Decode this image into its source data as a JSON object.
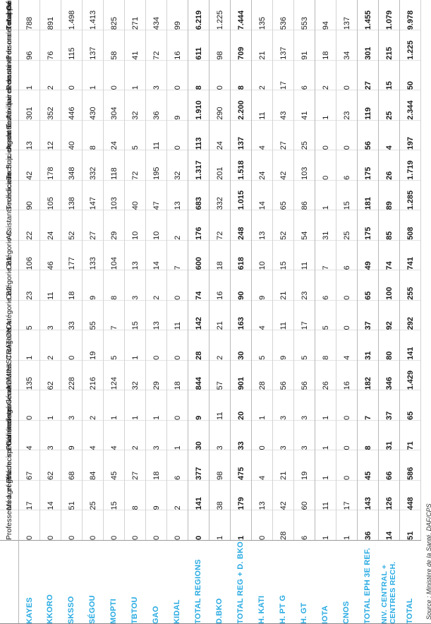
{
  "meta": {
    "accent_color": "#29abe2",
    "source_note": "Source : Ministère de la Santé, DAF/CPS"
  },
  "table": {
    "stub_header": "",
    "columns": [
      {
        "key": "prof_agreges",
        "label": "Professeurs agrégés",
        "bold": false
      },
      {
        "key": "med_pharm_spec",
        "label": "Méd. et Pharm. spécialistes",
        "bold": false
      },
      {
        "key": "med_gen",
        "label": "Médecins Généralistes",
        "bold": false
      },
      {
        "key": "pharm_gen",
        "label": "Pharmaciens Généralistes",
        "bold": false
      },
      {
        "key": "ingenieurs",
        "label": "Ingénieurs",
        "bold": false
      },
      {
        "key": "administration",
        "label": "ADMINISTRATION",
        "bold": false
      },
      {
        "key": "cat_a",
        "label": "Catégorie A",
        "bold": false
      },
      {
        "key": "cat_b2",
        "label": "Catégorie B2",
        "bold": false
      },
      {
        "key": "cat_b1",
        "label": "Catégorie B1",
        "bold": false
      },
      {
        "key": "cat_c",
        "label": "Catégorie C",
        "bold": false
      },
      {
        "key": "assist_med",
        "label": "Assistants médicaux",
        "bold": false
      },
      {
        "key": "tech_sup",
        "label": "Techniciens Sup. de santé",
        "bold": false
      },
      {
        "key": "tech_sante",
        "label": "Techniciens de santé",
        "bold": false
      },
      {
        "key": "agent_tech",
        "label": "Agent Technique de santé",
        "bold": false
      },
      {
        "key": "aux_sante",
        "label": "Auxiliaires de santé",
        "bold": false
      },
      {
        "key": "pers_maint",
        "label": "Personnel de maintenance",
        "bold": false
      },
      {
        "key": "pers_appui",
        "label": "Personnel d'appui",
        "bold": false
      },
      {
        "key": "total_general",
        "label": "Total Général",
        "bold": true
      }
    ],
    "rows": [
      {
        "label": "KAYES",
        "two_line": false,
        "bold": false,
        "band": false,
        "values": [
          "0",
          "17",
          "67",
          "4",
          "0",
          "135",
          "1",
          "5",
          "23",
          "106",
          "22",
          "90",
          "42",
          "13",
          "301",
          "1",
          "96",
          "788"
        ]
      },
      {
        "label": "KKORO",
        "two_line": false,
        "bold": false,
        "band": false,
        "values": [
          "0",
          "14",
          "62",
          "3",
          "1",
          "62",
          "2",
          "3",
          "11",
          "46",
          "24",
          "105",
          "178",
          "12",
          "352",
          "2",
          "76",
          "891"
        ]
      },
      {
        "label": "SKSSO",
        "two_line": false,
        "bold": false,
        "band": false,
        "values": [
          "0",
          "51",
          "68",
          "9",
          "3",
          "228",
          "0",
          "33",
          "18",
          "177",
          "52",
          "138",
          "348",
          "40",
          "446",
          "0",
          "115",
          "1.498"
        ]
      },
      {
        "label": "SÉGOU",
        "two_line": false,
        "bold": false,
        "band": false,
        "values": [
          "0",
          "25",
          "84",
          "4",
          "2",
          "216",
          "19",
          "55",
          "9",
          "133",
          "27",
          "147",
          "332",
          "8",
          "430",
          "1",
          "137",
          "1.413"
        ]
      },
      {
        "label": "MOPTI",
        "two_line": false,
        "bold": false,
        "band": false,
        "values": [
          "0",
          "15",
          "45",
          "4",
          "1",
          "124",
          "5",
          "7",
          "8",
          "104",
          "29",
          "103",
          "118",
          "24",
          "304",
          "0",
          "58",
          "825"
        ]
      },
      {
        "label": "TBTOU",
        "two_line": false,
        "bold": false,
        "band": false,
        "values": [
          "0",
          "8",
          "27",
          "2",
          "1",
          "32",
          "1",
          "15",
          "3",
          "13",
          "10",
          "40",
          "72",
          "5",
          "32",
          "1",
          "41",
          "271"
        ]
      },
      {
        "label": "GAO",
        "two_line": false,
        "bold": false,
        "band": false,
        "values": [
          "0",
          "9",
          "18",
          "3",
          "1",
          "29",
          "0",
          "13",
          "2",
          "14",
          "10",
          "47",
          "195",
          "11",
          "36",
          "3",
          "72",
          "434"
        ]
      },
      {
        "label": "KIDAL",
        "two_line": false,
        "bold": false,
        "band": true,
        "values": [
          "0",
          "2",
          "6",
          "1",
          "0",
          "18",
          "0",
          "11",
          "0",
          "7",
          "2",
          "13",
          "32",
          "0",
          "9",
          "0",
          "16",
          "99"
        ]
      },
      {
        "label": "TOTAL REGIONS",
        "two_line": false,
        "bold": true,
        "band": true,
        "values": [
          "0",
          "141",
          "377",
          "30",
          "9",
          "844",
          "28",
          "142",
          "74",
          "600",
          "176",
          "683",
          "1.317",
          "113",
          "1.910",
          "8",
          "611",
          "6.219"
        ]
      },
      {
        "label": "D.BKO",
        "two_line": false,
        "bold": false,
        "band": true,
        "values": [
          "1",
          "38",
          "98",
          "3",
          "11",
          "57",
          "2",
          "21",
          "16",
          "18",
          "72",
          "332",
          "201",
          "24",
          "290",
          "0",
          "98",
          "1.225"
        ]
      },
      {
        "label": "TOTAL REG + D. BKO",
        "two_line": false,
        "bold": true,
        "band": true,
        "values": [
          "1",
          "179",
          "475",
          "33",
          "20",
          "901",
          "30",
          "163",
          "90",
          "618",
          "248",
          "1.015",
          "1.518",
          "137",
          "2.200",
          "8",
          "709",
          "7.444"
        ]
      },
      {
        "label": "H. KATI",
        "two_line": false,
        "bold": false,
        "band": false,
        "values": [
          "0",
          "13",
          "4",
          "0",
          "1",
          "28",
          "5",
          "4",
          "9",
          "10",
          "13",
          "14",
          "24",
          "4",
          "11",
          "2",
          "21",
          "135"
        ]
      },
      {
        "label": "H. PT G",
        "two_line": false,
        "bold": false,
        "band": false,
        "values": [
          "28",
          "42",
          "21",
          "3",
          "3",
          "56",
          "9",
          "11",
          "21",
          "15",
          "52",
          "65",
          "42",
          "27",
          "43",
          "17",
          "137",
          "536"
        ]
      },
      {
        "label": "H. GT",
        "two_line": false,
        "bold": false,
        "band": true,
        "values": [
          "6",
          "60",
          "19",
          "3",
          "3",
          "56",
          "5",
          "17",
          "23",
          "11",
          "54",
          "86",
          "103",
          "25",
          "41",
          "6",
          "91",
          "553"
        ]
      },
      {
        "label": "IOTA",
        "two_line": false,
        "bold": false,
        "band": false,
        "values": [
          "1",
          "11",
          "1",
          "1",
          "1",
          "26",
          "8",
          "5",
          "6",
          "7",
          "31",
          "1",
          "0",
          "0",
          "1",
          "2",
          "18",
          "94"
        ]
      },
      {
        "label": "CNOS",
        "two_line": false,
        "bold": false,
        "band": true,
        "values": [
          "1",
          "17",
          "0",
          "0",
          "0",
          "16",
          "4",
          "0",
          "0",
          "6",
          "25",
          "15",
          "6",
          "0",
          "23",
          "0",
          "34",
          "137"
        ]
      },
      {
        "label": "TOTAL EPH 3E REF.",
        "two_line": false,
        "bold": true,
        "band": true,
        "values": [
          "36",
          "143",
          "45",
          "8",
          "7",
          "182",
          "31",
          "37",
          "65",
          "49",
          "175",
          "181",
          "175",
          "56",
          "119",
          "27",
          "301",
          "1.455"
        ]
      },
      {
        "label": "NIV. CENTRAL + CENTRES RECH.",
        "two_line": true,
        "bold": true,
        "band": true,
        "values": [
          "14",
          "126",
          "66",
          "31",
          "37",
          "346",
          "80",
          "92",
          "100",
          "74",
          "85",
          "89",
          "26",
          "4",
          "25",
          "15",
          "215",
          "1.079"
        ]
      },
      {
        "label": "TOTAL",
        "two_line": false,
        "bold": true,
        "band": false,
        "total": true,
        "values": [
          "51",
          "448",
          "586",
          "71",
          "65",
          "1.429",
          "141",
          "292",
          "255",
          "741",
          "508",
          "1.285",
          "1.719",
          "197",
          "2.344",
          "50",
          "1.225",
          "9.978"
        ]
      }
    ]
  }
}
